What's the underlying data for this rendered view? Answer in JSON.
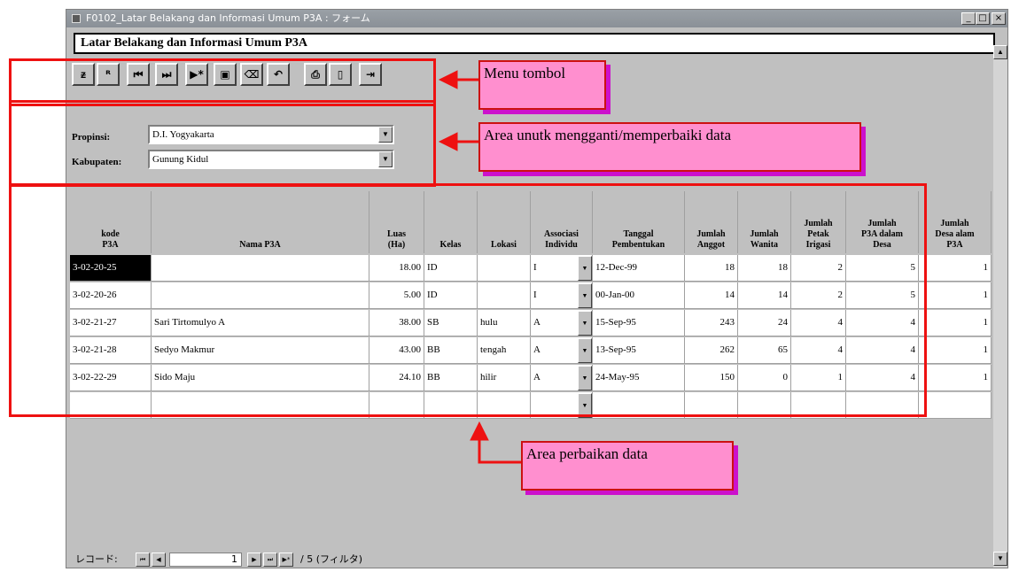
{
  "window": {
    "title": "F0102_Latar Belakang dan Informasi Umum P3A : フォーム",
    "min_label": "_",
    "max_label": "□",
    "close_label": "×"
  },
  "form_header": "Latar Belakang dan Informasi Umum P3A",
  "toolbar": {
    "buttons": [
      {
        "icon": "binoculars-icon",
        "glyph": "ᵶ"
      },
      {
        "icon": "find-next-icon",
        "glyph": "ᴿ"
      },
      {
        "icon": "first-record-icon",
        "glyph": "⏮"
      },
      {
        "icon": "last-record-icon",
        "glyph": "⏭"
      },
      {
        "icon": "new-record-icon",
        "glyph": "▶*"
      },
      {
        "icon": "save-icon",
        "glyph": "▣"
      },
      {
        "icon": "delete-icon",
        "glyph": "⌫"
      },
      {
        "icon": "undo-icon",
        "glyph": "↶"
      },
      {
        "icon": "print-icon",
        "glyph": "⎙"
      },
      {
        "icon": "preview-icon",
        "glyph": "▯"
      },
      {
        "icon": "exit-icon",
        "glyph": "⇥"
      }
    ]
  },
  "filter": {
    "propinsi_label": "Propinsi:",
    "propinsi_value": "D.I. Yogyakarta",
    "kabupaten_label": "Kabupaten:",
    "kabupaten_value": "Gunung Kidul"
  },
  "table": {
    "headers": [
      "kode\nP3A",
      "Nama P3A",
      "Luas\n(Ha)",
      "Kelas",
      "Lokasi",
      "Associasi\nIndividu",
      "Tanggal\nPembentukan",
      "Jumlah\nAnggot",
      "Jumlah\nWanita",
      "Jumlah\nPetak\nIrigasi",
      "Jumlah\nP3A dalam\nDesa",
      "Jumlah\nDesa alam\nP3A"
    ],
    "rows": [
      [
        "3-02-20-25",
        "",
        "18.00",
        "ID",
        "",
        "I",
        "12-Dec-99",
        "18",
        "18",
        "2",
        "5",
        "1"
      ],
      [
        "3-02-20-26",
        "",
        "5.00",
        "ID",
        "",
        "I",
        "00-Jan-00",
        "14",
        "14",
        "2",
        "5",
        "1"
      ],
      [
        "3-02-21-27",
        "Sari Tirtomulyo A",
        "38.00",
        "SB",
        "hulu",
        "A",
        "15-Sep-95",
        "243",
        "24",
        "4",
        "4",
        "1"
      ],
      [
        "3-02-21-28",
        "Sedyo Makmur",
        "43.00",
        "BB",
        "tengah",
        "A",
        "13-Sep-95",
        "262",
        "65",
        "4",
        "4",
        "1"
      ],
      [
        "3-02-22-29",
        "Sido Maju",
        "24.10",
        "BB",
        "hilir",
        "A",
        "24-May-95",
        "150",
        "0",
        "1",
        "4",
        "1"
      ],
      [
        "",
        "",
        "",
        "",
        "",
        "",
        "",
        "",
        "",
        "",
        "",
        ""
      ]
    ]
  },
  "record_nav": {
    "label": "レコード:",
    "current": "1",
    "of_text": "/ 5 (フィルタ)"
  },
  "annotations": {
    "menu": "Menu tombol",
    "edit_area": "Area unutk mengganti/memperbaiki data",
    "data_area": "Area perbaikan data"
  },
  "colors": {
    "annotation_red": "#ee1111",
    "callout_fill": "#ff8fcf",
    "callout_shadow": "#cc11cc",
    "window_gray": "#c0c0c0"
  }
}
